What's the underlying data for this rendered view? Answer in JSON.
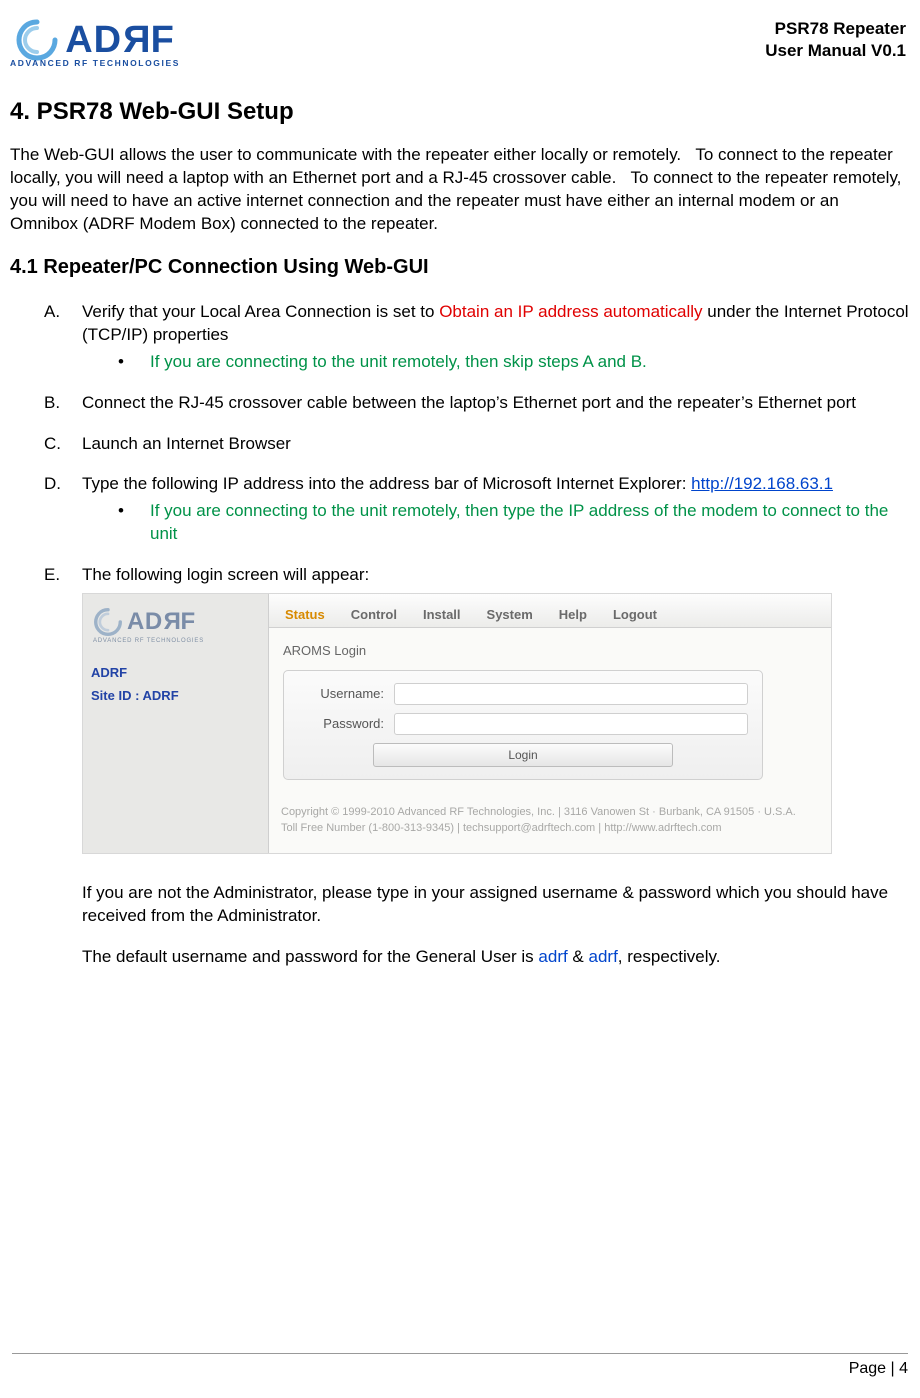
{
  "header": {
    "logo_text": "ADRF",
    "logo_sub": "ADVANCED RF TECHNOLOGIES",
    "doc_title_line1": "PSR78 Repeater",
    "doc_title_line2": "User Manual V0.1"
  },
  "h1": "4. PSR78 Web-GUI Setup",
  "intro": "The Web-GUI allows the user to communicate with the repeater either locally or remotely.   To connect to the repeater locally, you will need a laptop with an Ethernet port and a RJ-45 crossover cable.   To connect to the repeater remotely, you will need to have an active internet connection and the repeater must have either an internal modem or an Omnibox (ADRF Modem Box) connected to the repeater.",
  "h2": "4.1 Repeater/PC Connection Using Web-GUI",
  "steps": {
    "a_marker": "A.",
    "a_pre": "Verify that your Local Area Connection is set to ",
    "a_red": "Obtain an IP address automatically",
    "a_post": " under the Internet Protocol (TCP/IP) properties",
    "a_bullet": "If you are connecting to the unit remotely, then skip steps A and B.",
    "b_marker": "B.",
    "b_text": "Connect the RJ-45 crossover cable between the laptop’s Ethernet port and the repeater’s Ethernet port",
    "c_marker": "C.",
    "c_text": "Launch an Internet Browser",
    "d_marker": "D.",
    "d_pre": "Type the following IP address into the address bar of Microsoft Internet Explorer: ",
    "d_link": "http://192.168.63.1",
    "d_bullet": "If you are connecting to the unit remotely, then type the IP address of the modem to connect to the unit",
    "e_marker": "E.",
    "e_text": "The following login screen will appear:",
    "after1": "If you are not the Administrator, please type in your assigned username & password which you should have received from the Administrator.",
    "after2_pre": "The default username and password for the General User is ",
    "after2_u": "adrf",
    "after2_mid": " & ",
    "after2_p": "adrf",
    "after2_post": ", respectively."
  },
  "screenshot": {
    "logo_text": "ADRF",
    "logo_sub": "ADVANCED RF TECHNOLOGIES",
    "side_item1": "ADRF",
    "side_item2": "Site ID : ADRF",
    "tabs": {
      "status": "Status",
      "control": "Control",
      "install": "Install",
      "system": "System",
      "help": "Help",
      "logout": "Logout"
    },
    "panel_title": "AROMS Login",
    "username_label": "Username:",
    "password_label": "Password:",
    "username_value": "",
    "password_value": "",
    "login_button": "Login",
    "footer_line1": "Copyright © 1999-2010 Advanced RF Technologies, Inc. | 3116 Vanowen St · Burbank, CA 91505 · U.S.A.",
    "footer_line2": "Toll Free Number (1-800-313-9345) | techsupport@adrftech.com | http://www.adrftech.com"
  },
  "page_footer": "Page | 4"
}
